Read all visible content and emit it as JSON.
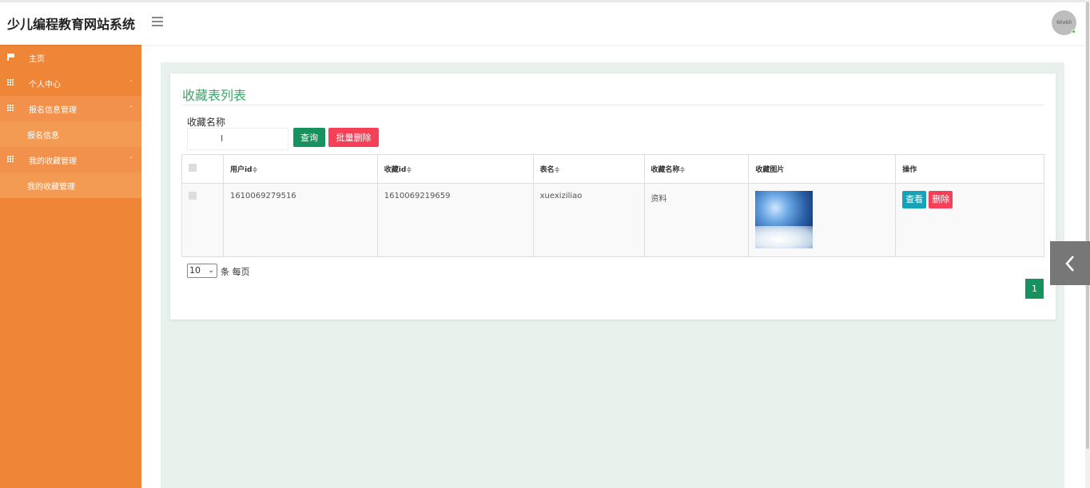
{
  "app": {
    "title": "少儿编程教育网站系统",
    "avatar_text": "60x60"
  },
  "sidebar": {
    "items": [
      {
        "label": "主页"
      },
      {
        "label": "个人中心",
        "chevron": "˅"
      },
      {
        "label": "报名信息管理",
        "chevron": "˄"
      },
      {
        "label": "报名信息"
      },
      {
        "label": "我的收藏管理",
        "chevron": "˄"
      },
      {
        "label": "我的收藏管理"
      }
    ]
  },
  "main": {
    "title": "收藏表列表",
    "search": {
      "label": "收藏名称",
      "value": "",
      "cursor": "I"
    },
    "buttons": {
      "query": "查询",
      "batch_delete": "批量删除"
    },
    "table": {
      "headers": [
        "用户id",
        "收藏id",
        "表名",
        "收藏名称",
        "收藏图片",
        "操作"
      ],
      "sort_glyph": "≑",
      "rows": [
        {
          "user_id": "1610069279516",
          "collect_id": "1610069219659",
          "table_name": "xuexiziliao",
          "collect_name": "资料",
          "image": "cloud-landscape-image",
          "actions": {
            "view": "查看",
            "delete": "删除"
          }
        }
      ]
    },
    "pagination": {
      "page_size": "10",
      "page_size_suffix": "条 每页",
      "current_page": "1"
    }
  },
  "colors": {
    "sidebar": "#ef8537",
    "accent_green": "#17915d",
    "danger": "#f54058",
    "info": "#17a2b8",
    "title_green": "#3fa36a"
  }
}
